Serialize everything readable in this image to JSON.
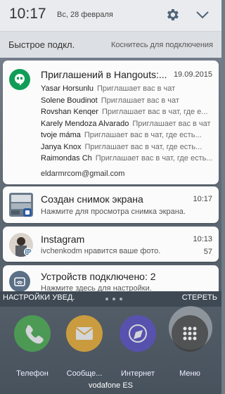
{
  "header": {
    "time": "10:17",
    "date": "Вс, 28 февраля"
  },
  "quick_connect": {
    "title": "Быстрое подкл.",
    "action": "Коснитесь для подключения"
  },
  "notifications": {
    "hangouts": {
      "title": "Приглашений в Hangouts:...",
      "time": "19.09.2015",
      "rows": [
        {
          "name": "Yasar Horsunlu",
          "msg": "Приглашает вас в чат"
        },
        {
          "name": "Solene Boudinot",
          "msg": "Приглашает вас в чат"
        },
        {
          "name": "Rovshan Kenqer",
          "msg": "Приглашает вас в чат, где е..."
        },
        {
          "name": "Karely Mendoza Alvarado",
          "msg": "Приглашает вас в чат"
        },
        {
          "name": "tvoje máma",
          "msg": "Приглашает вас в чат, где есть..."
        },
        {
          "name": "Janya Knox",
          "msg": "Приглашает вас в чат, где есть..."
        },
        {
          "name": "Raimondas Ch",
          "msg": "Приглашает вас в чат, где есть..."
        }
      ],
      "account": "eldarmrcom@gmail.com",
      "color": "#0f9d58"
    },
    "screenshot": {
      "title": "Создан снимок экрана",
      "time": "10:17",
      "text": "Нажмите для просмотра снимка экрана."
    },
    "instagram": {
      "title": "Instagram",
      "time": "10:13",
      "text": "ivchenkodm нравится ваше фото.",
      "count": "57"
    },
    "usb": {
      "title": "Устройств подключено: 2",
      "text": "Нажмите здесь для настройки.",
      "color": "#5b6f86"
    }
  },
  "bottom_bar": {
    "settings_label": "НАСТРОЙКИ УВЕД.",
    "clear_label": "СТЕРЕТЬ"
  },
  "dock": [
    {
      "label": "Телефон",
      "icon": "phone-icon",
      "color": "#4caf50"
    },
    {
      "label": "Сообще...",
      "icon": "message-icon",
      "color": "#f3b233"
    },
    {
      "label": "Интернет",
      "icon": "internet-icon",
      "color": "#5b4fc8"
    },
    {
      "label": "Меню",
      "icon": "apps-icon",
      "color": "#3d3d3d"
    }
  ],
  "carrier": "vodafone ES"
}
